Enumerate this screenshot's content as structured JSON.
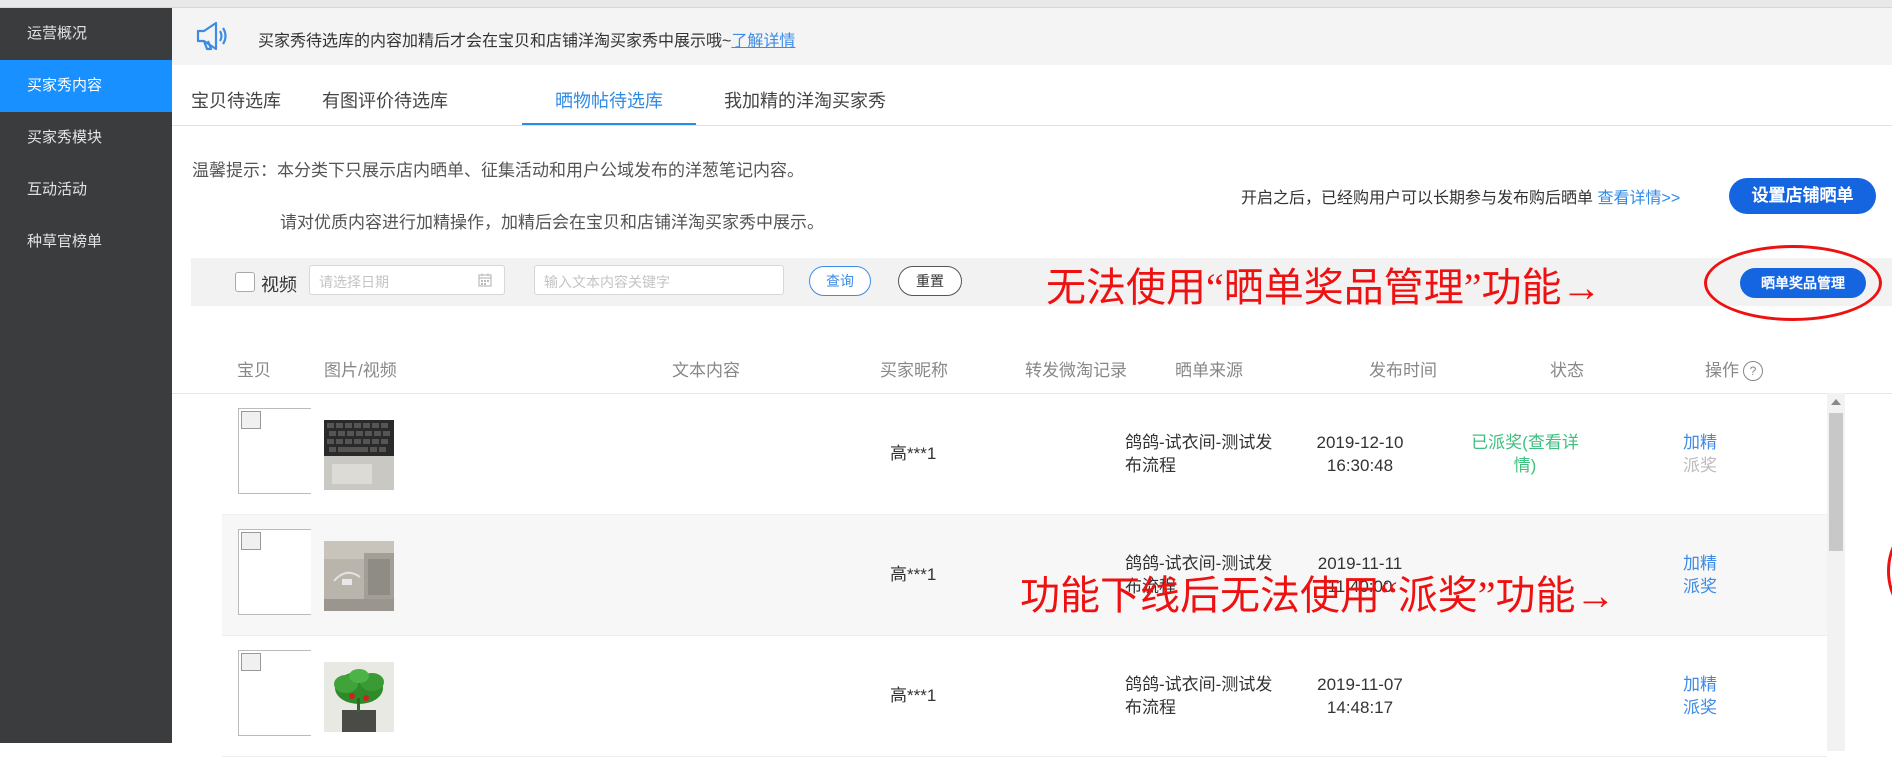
{
  "sidebar": {
    "items": [
      {
        "label": "运营概况"
      },
      {
        "label": "买家秀内容"
      },
      {
        "label": "买家秀模块"
      },
      {
        "label": "互动活动"
      },
      {
        "label": "种草官榜单"
      }
    ],
    "active_index": 1,
    "active_color": "#1890ff"
  },
  "notice": {
    "icon": "megaphone-icon",
    "text": "买家秀待选库的内容加精后才会在宝贝和店铺洋淘买家秀中展示哦~",
    "link": "了解详情"
  },
  "tabs": [
    {
      "label": "宝贝待选库"
    },
    {
      "label": "有图评价待选库"
    },
    {
      "label": "晒物帖待选库"
    },
    {
      "label": "我加精的洋淘买家秀"
    }
  ],
  "active_tab_index": 2,
  "tips": {
    "line1": "温馨提示：本分类下只展示店内晒单、征集活动和用户公域发布的洋葱笔记内容。",
    "line2": "请对优质内容进行加精操作，加精后会在宝贝和店铺洋淘买家秀中展示。"
  },
  "right_info": {
    "text": "开启之后，已经购用户可以长期参与发布购后晒单",
    "more_link": "查看详情>>",
    "setup_button": "设置店铺晒单"
  },
  "filter": {
    "video_label": "视频",
    "date_placeholder": "请选择日期",
    "keyword_placeholder": "输入文本内容关键字",
    "query_button": "查询",
    "reset_button": "重置",
    "prize_button": "晒单奖品管理"
  },
  "annotations": {
    "prize_note": "无法使用“晒单奖品管理”功能→",
    "award_note": "功能下线后无法使用“派奖”功能→",
    "color": "#e11111"
  },
  "table": {
    "headers": {
      "item": "宝贝",
      "media": "图片/视频",
      "text": "文本内容",
      "nick": "买家昵称",
      "weibo": "转发微淘记录",
      "source": "晒单来源",
      "time": "发布时间",
      "status": "状态",
      "ops": "操作"
    },
    "rows": [
      {
        "nick": "高***1",
        "source": "鸽鸽-试衣间-测试发布流程",
        "time": "2019-12-10 16:30:48",
        "status": "已派奖(查看详情)",
        "op1": "加精",
        "op2": "派奖"
      },
      {
        "nick": "高***1",
        "source": "鸽鸽-试衣间-测试发布流程",
        "time": "2019-11-11 11:40:00",
        "status": "",
        "op1": "加精",
        "op2": "派奖"
      },
      {
        "nick": "高***1",
        "source": "鸽鸽-试衣间-测试发布流程",
        "time": "2019-11-07 14:48:17",
        "status": "",
        "op1": "加精",
        "op2": "派奖"
      }
    ]
  }
}
